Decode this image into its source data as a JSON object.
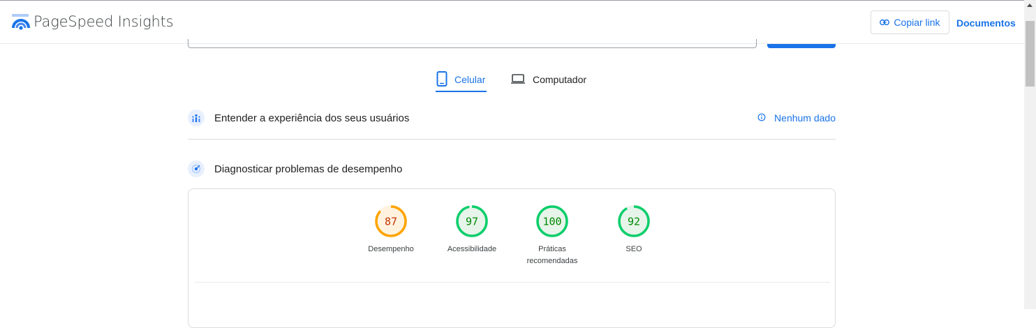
{
  "header": {
    "brand": "PageSpeed Insights",
    "copy_link": "Copiar link",
    "docs": "Documentos"
  },
  "tabs": [
    {
      "label": "Celular",
      "active": true,
      "icon": "smartphone-icon"
    },
    {
      "label": "Computador",
      "active": false,
      "icon": "laptop-icon"
    }
  ],
  "field_data": {
    "title": "Entender a experiência dos seus usuários",
    "status": "Nenhum dado",
    "icon": "users-icon"
  },
  "lab_data": {
    "title": "Diagnosticar problemas de desempenho",
    "icon": "diagnostics-icon"
  },
  "scores": [
    {
      "value": "87",
      "label": "Desempenho",
      "score": 87,
      "color": "#ffa400",
      "text_color": "#c33300",
      "track": "#fff3e0"
    },
    {
      "value": "97",
      "label": "Acessibilidade",
      "score": 97,
      "color": "#0cce6b",
      "text_color": "#008800",
      "track": "#e6f4ea"
    },
    {
      "value": "100",
      "label": "Práticas recomendadas",
      "score": 100,
      "color": "#0cce6b",
      "text_color": "#008800",
      "track": "#e6f4ea"
    },
    {
      "value": "92",
      "label": "SEO",
      "score": 92,
      "color": "#0cce6b",
      "text_color": "#008800",
      "track": "#e6f4ea"
    }
  ],
  "colors": {
    "accent": "#1a73e8",
    "pass": "#0cce6b",
    "average": "#ffa400"
  }
}
